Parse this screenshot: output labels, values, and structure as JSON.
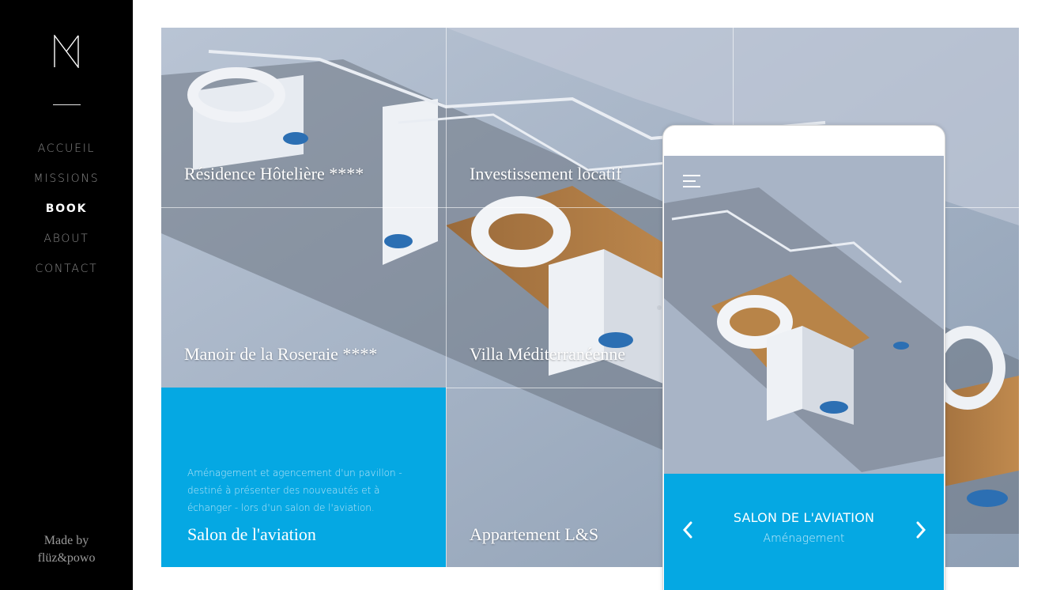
{
  "sidebar": {
    "logo_icon": "monogram-n-icon",
    "nav": [
      {
        "label": "ACCUEIL",
        "active": false
      },
      {
        "label": "MISSIONS",
        "active": false
      },
      {
        "label": "BOOK",
        "active": true
      },
      {
        "label": "ABOUT",
        "active": false
      },
      {
        "label": "CONTACT",
        "active": false
      }
    ],
    "credit_line1": "Made by",
    "credit_line2": "flüz&powo"
  },
  "grid": {
    "tiles": [
      {
        "title": "Résidence Hôtelière ****"
      },
      {
        "title": "Investissement locatif"
      },
      {
        "title": "Manoir de la Roseraie ****"
      },
      {
        "title": "Villa Méditerranéenne"
      },
      {
        "title": "Salon de l'aviation",
        "description": "Aménagement et agencement d'un pavillon - destiné à présenter des nouveautés et à échanger - lors d'un salon de l'aviation."
      },
      {
        "title": "Appartement L&S"
      }
    ]
  },
  "phone": {
    "menu_icon": "hamburger-menu-icon",
    "title": "SALON DE L'AVIATION",
    "subtitle": "Aménagement",
    "prev_icon": "chevron-left-icon",
    "next_icon": "chevron-right-icon"
  },
  "colors": {
    "sidebar_bg": "#000000",
    "accent_blue": "#05a8e3",
    "nav_inactive": "#8b8b8b",
    "nav_active": "#ffffff"
  }
}
